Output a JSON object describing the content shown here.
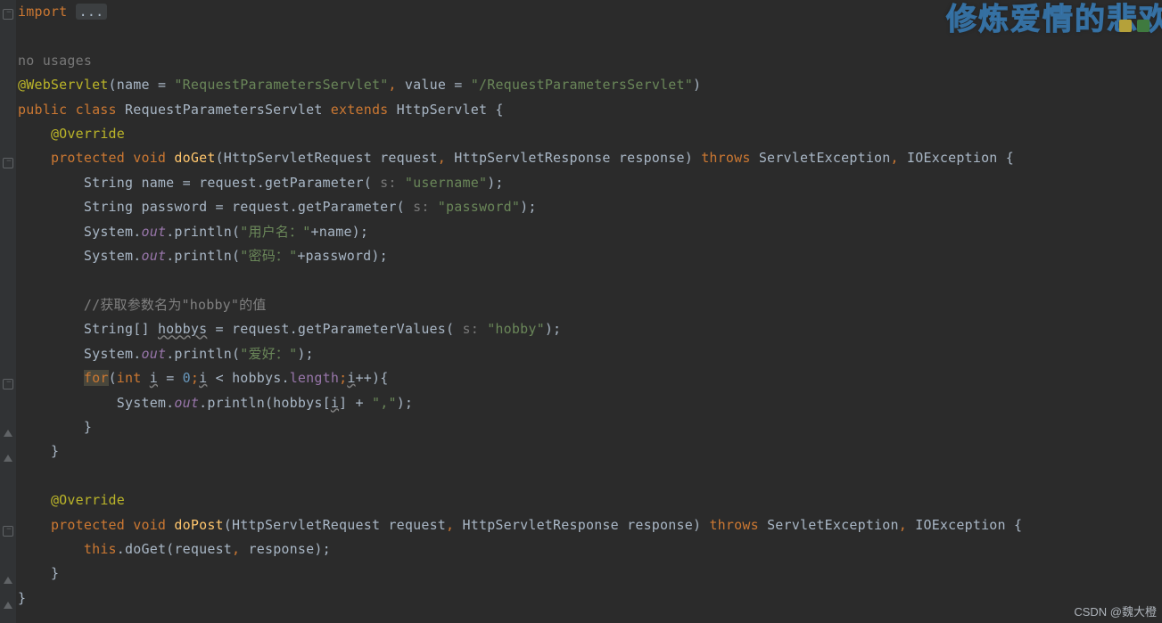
{
  "foldedImport": "import ",
  "ellipsisBox": "...",
  "usageHint": "no usages",
  "annotation": {
    "name": "@WebServlet",
    "paramName": "name",
    "nameValue": "\"RequestParametersServlet\"",
    "paramValue": "value",
    "valueValue": "\"/RequestParametersServlet\""
  },
  "classDecl": {
    "modifiers": "public class",
    "className": "RequestParametersServlet",
    "extendsKw": "extends",
    "superClass": "HttpServlet"
  },
  "override": "@Override",
  "doGet": {
    "mods": "protected void",
    "name": "doGet",
    "sig": "(HttpServletRequest request",
    "sig2": " HttpServletResponse response)",
    "throwsKw": "throws",
    "exc": "ServletException",
    "exc2": " IOException {"
  },
  "hintS": "s:",
  "lines": {
    "l1a": "String name = request.getParameter(",
    "l1s": " \"username\"",
    "l1b": ");",
    "l2a": "String password = request.getParameter(",
    "l2s": " \"password\"",
    "l2b": ");",
    "l3a": "System.",
    "l3out": "out",
    "l3b": ".println(",
    "l3s": "\"用户名：\"",
    "l3c": "+name);",
    "l4s": "\"密码：\"",
    "l4c": "+password);",
    "cmt": "//获取参数名为\"hobby\"的值",
    "l5a": "String[] ",
    "l5v": "hobbys",
    "l5b": " = request.getParameterValues(",
    "l5s": " \"hobby\"",
    "l5c": ");",
    "l6s": "\"爱好：\"",
    "l6b": ");",
    "forKw": "for",
    "forO": "(",
    "intKw": "int",
    "iVar": "i",
    "eq": " = ",
    "zero": "0",
    "sc1": ";",
    "lt": " < hobbys.",
    "len": "length",
    "sc2": ";",
    "pp": "++){",
    "l8a": "System.",
    "l8b": ".println(hobbys[",
    "l8c": "] + ",
    "l8s": "\",\"",
    "l8d": ");",
    "cb": "}"
  },
  "doPost": {
    "name": "doPost",
    "body1": "this",
    "body2": ".doGet(request",
    "body3": " response);"
  },
  "watermark": "修炼爱情的悲欢",
  "csdn": "CSDN @魏大橙"
}
